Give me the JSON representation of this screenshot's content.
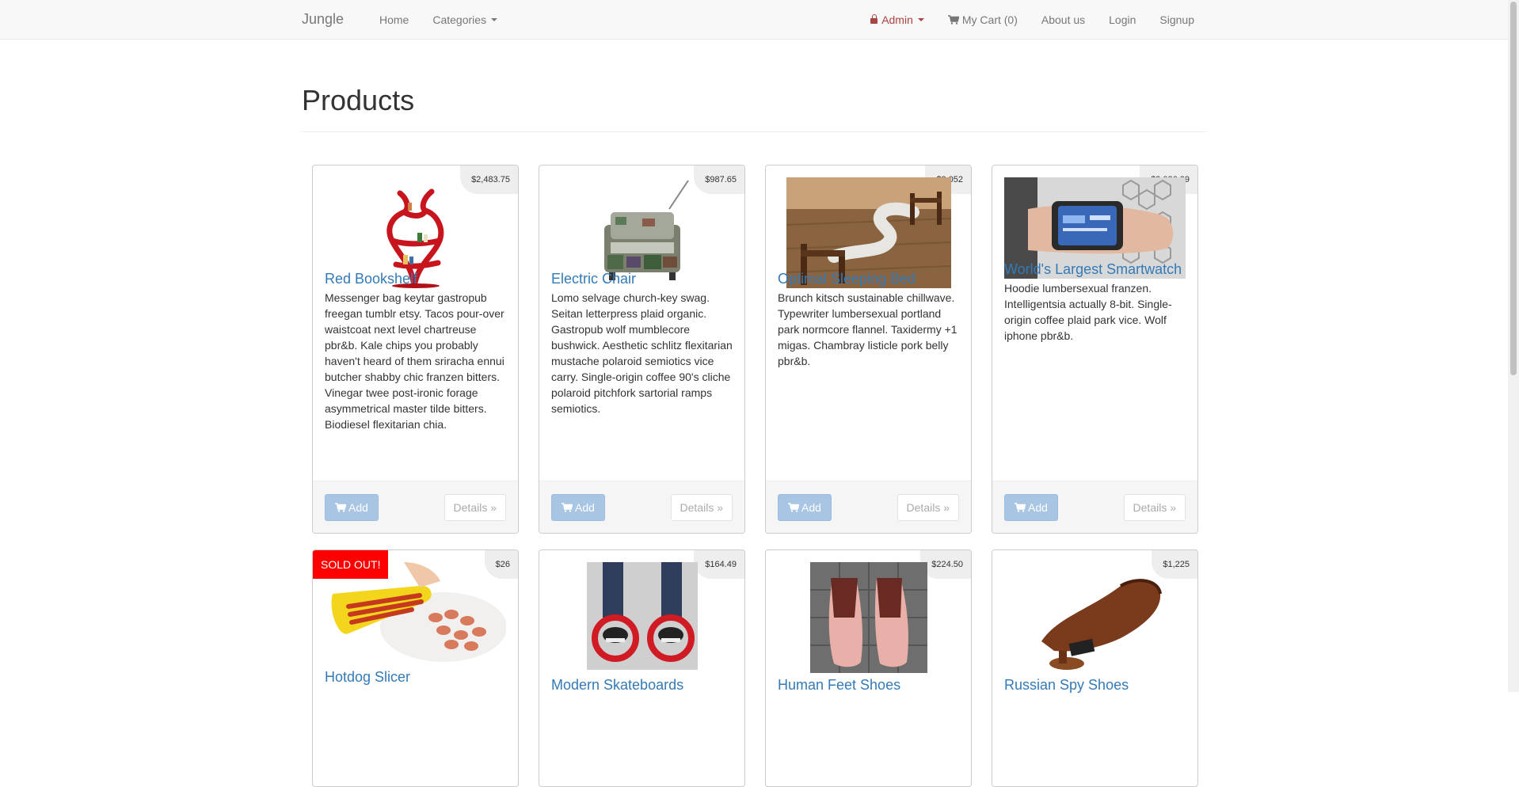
{
  "nav": {
    "brand": "Jungle",
    "home": "Home",
    "categories": "Categories",
    "admin": "Admin",
    "cart": "My Cart (0)",
    "about": "About us",
    "login": "Login",
    "signup": "Signup"
  },
  "page": {
    "title": "Products"
  },
  "buttons": {
    "add": "Add",
    "details": "Details »"
  },
  "products": [
    {
      "name": "Red Bookshelf",
      "price": "$2,483.75",
      "description": "Messenger bag keytar gastropub freegan tumblr etsy. Tacos pour-over waistcoat next level chartreuse pbr&b. Kale chips you probably haven't heard of them sriracha ennui butcher shabby chic franzen bitters. Vinegar twee post-ironic forage asymmetrical master tilde bitters. Biodiesel flexitarian chia."
    },
    {
      "name": "Electric Chair",
      "price": "$987.65",
      "description": "Lomo selvage church-key swag. Seitan letterpress plaid organic. Gastropub wolf mumblecore bushwick. Aesthetic schlitz flexitarian mustache polaroid semiotics vice carry. Single-origin coffee 90's cliche polaroid pitchfork sartorial ramps semiotics."
    },
    {
      "name": "Optimal Sleeping Bed",
      "price": "$3,052",
      "description": "Brunch kitsch sustainable chillwave. Typewriter lumbersexual portland park normcore flannel. Taxidermy +1 migas. Chambray listicle pork belly pbr&b."
    },
    {
      "name": "World's Largest Smartwatch",
      "price": "$2,026.29",
      "description": "Hoodie lumbersexual franzen. Intelligentsia actually 8-bit. Single-origin coffee plaid park vice. Wolf iphone pbr&b."
    },
    {
      "name": "Hotdog Slicer",
      "price": "$26",
      "badge": "SOLD OUT!"
    },
    {
      "name": "Modern Skateboards",
      "price": "$164.49"
    },
    {
      "name": "Human Feet Shoes",
      "price": "$224.50"
    },
    {
      "name": "Russian Spy Shoes",
      "price": "$1,225"
    }
  ]
}
